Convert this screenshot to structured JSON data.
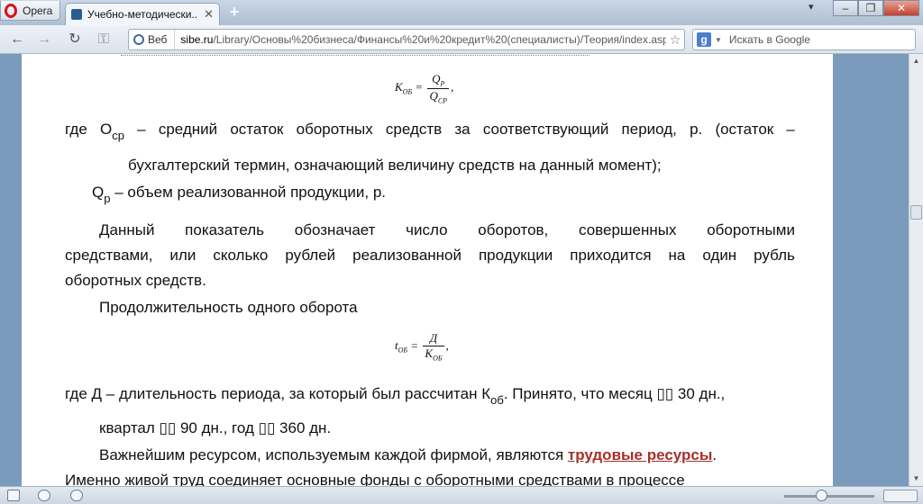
{
  "browser": {
    "menu_label": "Opera",
    "tab": {
      "title": "Учебно-методически..."
    },
    "address": {
      "badge": "Веб",
      "host": "sibe.ru",
      "path": "/Library/Основы%20бизнеса/Финансы%20и%20кредит%20(специалисты)/Теория/index.asp"
    },
    "search": {
      "placeholder": "Искать в Google"
    }
  },
  "content": {
    "formula1": {
      "lhs": "K",
      "lhs_sub": "ОБ",
      "num": "Q",
      "num_sub": "Р",
      "den": "Q",
      "den_sub": "СР"
    },
    "para1": {
      "l1_words": [
        "где",
        "О",
        "–",
        "средний",
        "остаток",
        "оборотных",
        "средств",
        "за",
        "соответствующий",
        "период,",
        "р.",
        "(остаток",
        "–"
      ],
      "l1_sub": "ср",
      "l2": "бухгалтерский термин, означающий величину средств на данный момент);",
      "l3_pre": "Q",
      "l3_sub": "р",
      "l3_post": " – объем реализованной продукции, р."
    },
    "para2": {
      "l1_words": [
        "Данный",
        "показатель",
        "обозначает",
        "число",
        "оборотов,",
        "совершенных",
        "оборотными"
      ],
      "l2_words": [
        "средствами,",
        "или",
        "сколько",
        "рублей",
        "реализованной",
        "продукции",
        "приходится",
        "на",
        "один",
        "рубль"
      ],
      "l3": "оборотных средств."
    },
    "para3": "Продолжительность одного оборота",
    "formula2": {
      "lhs": "t",
      "lhs_sub": "ОБ",
      "num": "Д",
      "den": "K",
      "den_sub": "ОБ"
    },
    "para4": {
      "l1_pre": "где Д – длительность периода, за который был рассчитан К",
      "l1_sub": "об",
      "l1_post": ". Принято, что месяц ▯▯ 30 дн.,",
      "l2": "квартал ▯▯ 90 дн., год ▯▯ 360 дн."
    },
    "para5": {
      "l1_pre": "Важнейшим ресурсом, используемым каждой фирмой, являются ",
      "l1_link": "трудовые ресурсы",
      "l1_post": ".",
      "l2": "Именно живой труд соединяет основные фонды с оборотными средствами в процессе"
    }
  }
}
